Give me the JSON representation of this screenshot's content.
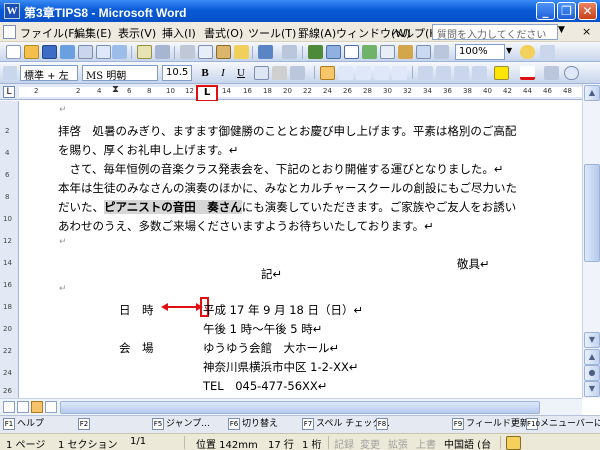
{
  "window": {
    "title": "第3章TIPS8 - Microsoft Word",
    "app_icon": "W"
  },
  "menu": {
    "items": [
      "ファイル(F)",
      "編集(E)",
      "表示(V)",
      "挿入(I)",
      "書式(O)",
      "ツール(T)",
      "罫線(A)",
      "ウィンドウ(W)",
      "ヘルプ(H)"
    ],
    "help_placeholder": "質問を入力してください",
    "close_glyph": "×"
  },
  "toolbar": {
    "zoom": "100%",
    "style": "標準 + 左",
    "font": "MS 明朝",
    "size": "10.5",
    "bold": "B",
    "italic": "I",
    "underline": "U"
  },
  "ruler": {
    "numbers": [
      "2",
      "2",
      "4",
      "6",
      "8",
      "10",
      "12",
      "14",
      "16",
      "18",
      "20",
      "22",
      "24",
      "26",
      "28",
      "30",
      "32",
      "34",
      "36",
      "38",
      "40",
      "42",
      "44",
      "46",
      "48"
    ],
    "tab_marker": "L",
    "tab_selector": "L",
    "vnumbers": [
      "2",
      "4",
      "6",
      "8",
      "10",
      "12",
      "14",
      "16",
      "18",
      "20",
      "22",
      "24",
      "26"
    ]
  },
  "document": {
    "lines": {
      "l0": "↵",
      "l1": "拝啓　処暑のみぎり、ますます御健勝のこととお慶び申し上げます。平素は格別のご高配",
      "l2": "を賜り、厚くお礼申し上げます。↵",
      "l3": "　さて、毎年恒例の音楽クラス発表会を、下記のとおり開催する運びとなりました。↵",
      "l4": "本年は生徒のみなさんの演奏のほかに、みなとカルチャースクールの創設にもご尽力いた",
      "l5a": "だいた、",
      "l5b": "ピアニストの音田　奏さん",
      "l5c": "にも演奏していただきます。ご家族やご友人をお誘い",
      "l6": "あわせのうえ、多数ご来場くださいますようお待ちいたしております。↵",
      "l7": "↵",
      "l8": "敬具↵",
      "l9": "記↵",
      "l10": "↵",
      "l11_label": "日　時",
      "l11_value": "平成 17 年 9 月 18 日（日）↵",
      "l12": "午後 1 時～午後 5 時↵",
      "l13_label": "会　場",
      "l13_value": "ゆうゆう会館　大ホール↵",
      "l14": "神奈川県横浜市中区 1-2-XX↵",
      "l15": "TEL　045-477-56XX↵"
    }
  },
  "fkeys": [
    {
      "key": "F1",
      "label": "ヘルプ",
      "dim": false
    },
    {
      "key": "F2",
      "label": "",
      "dim": true
    },
    {
      "key": "F5",
      "label": "ジャンプ...",
      "dim": false
    },
    {
      "key": "F6",
      "label": "切り替え",
      "dim": false
    },
    {
      "key": "F7",
      "label": "スペル チェック...",
      "dim": false
    },
    {
      "key": "F8",
      "label": "",
      "dim": true
    },
    {
      "key": "F9",
      "label": "フィールド更新",
      "dim": false
    },
    {
      "key": "F10",
      "label": "メニューバーに",
      "dim": false
    }
  ],
  "status": {
    "page": "1 ページ",
    "section": "1 セクション",
    "pages": "1/1",
    "position": "位置 142mm",
    "line": "17 行",
    "column": "1 桁",
    "rec": "記録",
    "trk": "変更",
    "ext": "拡張",
    "ovr": "上書",
    "lang": "中国語 (台"
  },
  "colors": {
    "annotation": "#e01010",
    "titlebar": "#0a5ad6"
  }
}
